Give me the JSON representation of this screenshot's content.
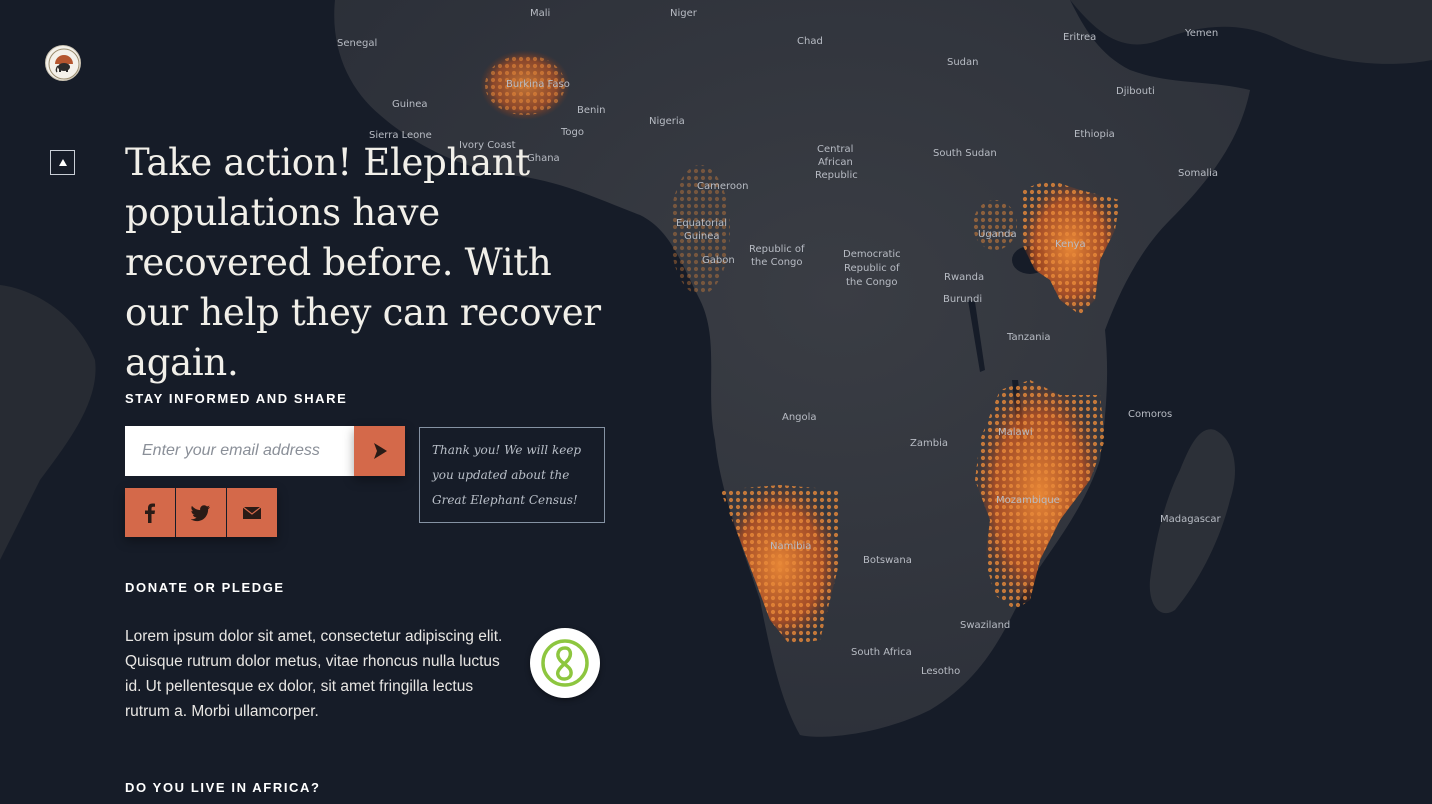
{
  "map": {
    "labels": [
      {
        "id": "mali",
        "text": "Mali"
      },
      {
        "id": "niger",
        "text": "Niger"
      },
      {
        "id": "chad",
        "text": "Chad"
      },
      {
        "id": "sudan",
        "text": "Sudan"
      },
      {
        "id": "eritrea",
        "text": "Eritrea"
      },
      {
        "id": "yemen",
        "text": "Yemen"
      },
      {
        "id": "senegal",
        "text": "Senegal"
      },
      {
        "id": "burkina",
        "text": "Burkina Faso"
      },
      {
        "id": "guinea",
        "text": "Guinea"
      },
      {
        "id": "benin",
        "text": "Benin"
      },
      {
        "id": "djibouti",
        "text": "Djibouti"
      },
      {
        "id": "nigeria",
        "text": "Nigeria"
      },
      {
        "id": "sierra",
        "text": "Sierra Leone"
      },
      {
        "id": "togo",
        "text": "Togo"
      },
      {
        "id": "ethiopia",
        "text": "Ethiopia"
      },
      {
        "id": "ivory",
        "text": "Ivory Coast"
      },
      {
        "id": "car1",
        "text": "Central"
      },
      {
        "id": "car2",
        "text": "African"
      },
      {
        "id": "car3",
        "text": "Republic"
      },
      {
        "id": "ghana",
        "text": "Ghana"
      },
      {
        "id": "ssudan",
        "text": "South Sudan"
      },
      {
        "id": "somalia",
        "text": "Somalia"
      },
      {
        "id": "cameroon",
        "text": "Cameroon"
      },
      {
        "id": "uganda",
        "text": "Uganda"
      },
      {
        "id": "kenya",
        "text": "Kenya"
      },
      {
        "id": "eqg1",
        "text": "Equatorial"
      },
      {
        "id": "eqg2",
        "text": "Guinea"
      },
      {
        "id": "roc1",
        "text": "Republic of"
      },
      {
        "id": "roc2",
        "text": "the Congo"
      },
      {
        "id": "drc1",
        "text": "Democratic"
      },
      {
        "id": "drc2",
        "text": "Republic of"
      },
      {
        "id": "drc3",
        "text": "the Congo"
      },
      {
        "id": "gabon",
        "text": "Gabon"
      },
      {
        "id": "rwanda",
        "text": "Rwanda"
      },
      {
        "id": "burundi",
        "text": "Burundi"
      },
      {
        "id": "tanzania",
        "text": "Tanzania"
      },
      {
        "id": "angola",
        "text": "Angola"
      },
      {
        "id": "comoros",
        "text": "Comoros"
      },
      {
        "id": "malawi",
        "text": "Malawi"
      },
      {
        "id": "zambia",
        "text": "Zambia"
      },
      {
        "id": "mozambique",
        "text": "Mozambique"
      },
      {
        "id": "madagascar",
        "text": "Madagascar"
      },
      {
        "id": "namibia",
        "text": "Namibia"
      },
      {
        "id": "botswana",
        "text": "Botswana"
      },
      {
        "id": "swaziland",
        "text": "Swaziland"
      },
      {
        "id": "southafrica",
        "text": "South Africa"
      },
      {
        "id": "lesotho",
        "text": "Lesotho"
      }
    ]
  },
  "logo": {
    "alt": "Great Elephant Census logo"
  },
  "nav": {
    "up_icon": "triangle-up-icon"
  },
  "headline": "Take action! Elephant populations have recovered before. With our help they can recover again.",
  "share_section": {
    "title": "STAY INFORMED AND SHARE",
    "email_placeholder": "Enter your email address",
    "submit_icon": "arrow-right-icon",
    "thanks_message": "Thank you! We will keep you updated about the Great Elephant Census!",
    "buttons": [
      {
        "icon": "facebook-icon"
      },
      {
        "icon": "twitter-icon"
      },
      {
        "icon": "email-icon"
      }
    ]
  },
  "donate_section": {
    "title": "DONATE OR PLEDGE",
    "text": "Lorem ipsum dolor sit amet, consectetur adipiscing elit. Quisque rutrum dolor metus, vitae rhoncus nulla luctus id. Ut pellentesque ex dolor, sit amet fringilla lectus rutrum a. Morbi ullamcorper.",
    "badge_icon": "pledge-logo-icon"
  },
  "africa_section": {
    "title": "DO YOU LIVE IN AFRICA?"
  },
  "colors": {
    "background": "#141a26",
    "accent": "#d4694a",
    "text": "#e8e6e3",
    "elephant_density": "#e07a2e",
    "pledge_green": "#8dc63f"
  }
}
